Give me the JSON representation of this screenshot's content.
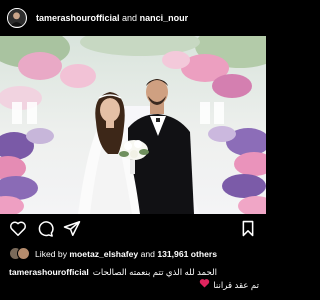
{
  "post": {
    "author": "tamerashourofficial",
    "connector": "and",
    "collaborator": "nanci_nour"
  },
  "likes": {
    "prefix": "Liked by",
    "user": "moetaz_elshafey",
    "middle": "and",
    "count": "131,961 others"
  },
  "caption": {
    "username": "tamerashourofficial",
    "text_line1": "الحمد لله الذي تتم بنعمته الصالحات",
    "text_line2": "تم عقد قراننا"
  },
  "icons": [
    "heart-icon",
    "comment-icon",
    "share-icon",
    "bookmark-icon",
    "red-heart-emoji"
  ],
  "colors": {
    "background": "#000000",
    "text": "#ffffff",
    "heart": "#e0245e"
  }
}
